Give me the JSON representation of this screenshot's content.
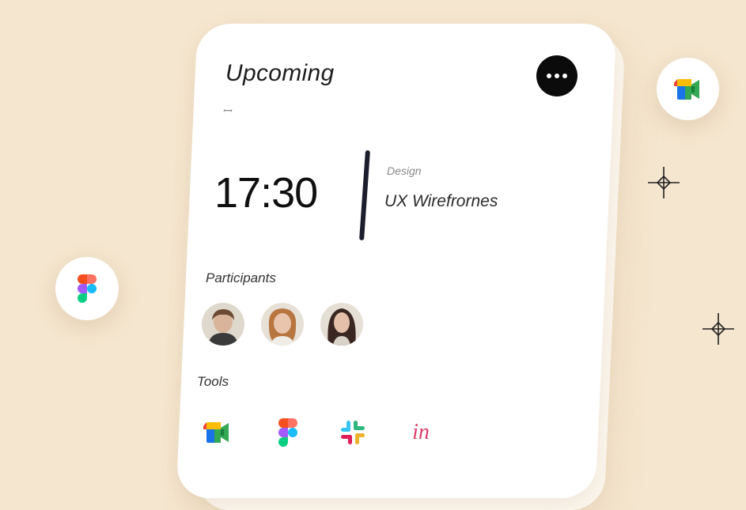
{
  "card": {
    "title": "Upcoming",
    "subtitle": "ꟷ",
    "time": "17:30",
    "label": "Design",
    "meeting_name": "UX Wirefrornes",
    "participants_label": "Participants",
    "tools_label": "Tools"
  },
  "participants": [
    {
      "name": "participant-1"
    },
    {
      "name": "participant-2"
    },
    {
      "name": "participant-3"
    }
  ],
  "tools": [
    {
      "icon": "google-meet-icon"
    },
    {
      "icon": "figma-icon"
    },
    {
      "icon": "slack-icon"
    },
    {
      "icon": "invision-icon",
      "text": "in"
    }
  ],
  "floating": [
    {
      "icon": "google-meet-icon"
    },
    {
      "icon": "figma-icon"
    }
  ]
}
